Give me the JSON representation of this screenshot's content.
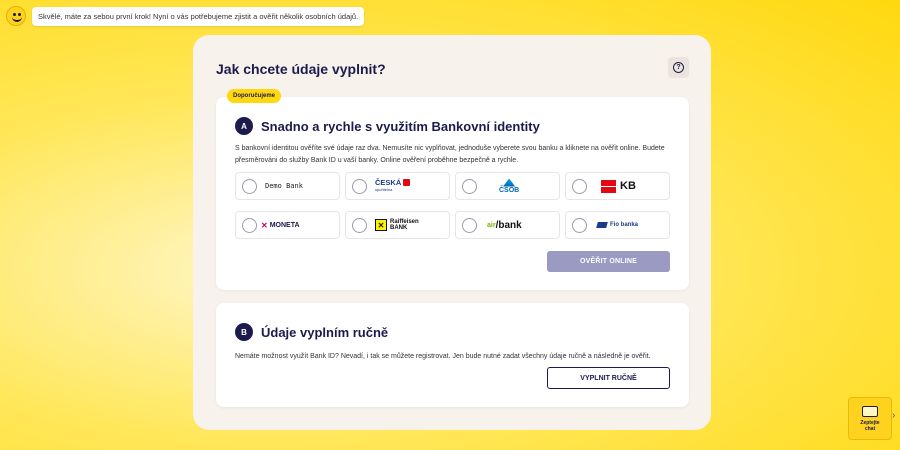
{
  "notice": {
    "text": "Skvělé, máte za sebou první krok! Nyní o vás potřebujeme zjistit a ověřit několik osobních údajů."
  },
  "form": {
    "title": "Jak chcete údaje vyplnit?",
    "help_icon": "question-circle-icon"
  },
  "option_a": {
    "badge": "Doporučujeme",
    "letter": "A",
    "title": "Snadno a rychle s využitím Bankovní identity",
    "description": "S bankovní identitou ověříte své údaje raz dva. Nemusíte nic vyplňovat, jednoduše vyberete svou banku a kliknete na ověřit online. Budete přesměrováni do služby Bank ID u vaší banky. Online ověření proběhne bezpečně a rychle.",
    "banks": [
      {
        "name": "Demo Bank",
        "selected": false
      },
      {
        "name": "Česká spořitelna",
        "logo_line1": "ČESKÁ",
        "logo_line2": "spořitelna",
        "selected": false
      },
      {
        "name": "ČSOB",
        "logo": "ČSOB",
        "selected": false
      },
      {
        "name": "KB",
        "logo": "KB",
        "selected": false
      },
      {
        "name": "MONETA",
        "logo": "MONETA",
        "selected": false
      },
      {
        "name": "Raiffeisen BANK",
        "logo_line1": "Raiffeisen",
        "logo_line2": "BANK",
        "selected": false
      },
      {
        "name": "Air Bank",
        "logo_air": "air",
        "logo_bank": "bank",
        "selected": false
      },
      {
        "name": "Fio banka",
        "logo": "Fio banka",
        "selected": false
      }
    ],
    "button_label": "OVĚŘIT ONLINE"
  },
  "option_b": {
    "letter": "B",
    "title": "Údaje vyplním ručně",
    "description": "Nemáte možnost využít Bank ID? Nevadí, i tak se můžete registrovat. Jen bude nutné zadat všechny údaje ručně a následně je ověřit.",
    "button_label": "VYPLNIT RUČNĚ"
  },
  "chat": {
    "label_line1": "Zeptejte",
    "label_line2": "chat",
    "icon": "chat-icon"
  },
  "colors": {
    "brand_yellow": "#ffd80f",
    "navy": "#1b1b4d",
    "disabled_button": "#9a9ac2"
  }
}
